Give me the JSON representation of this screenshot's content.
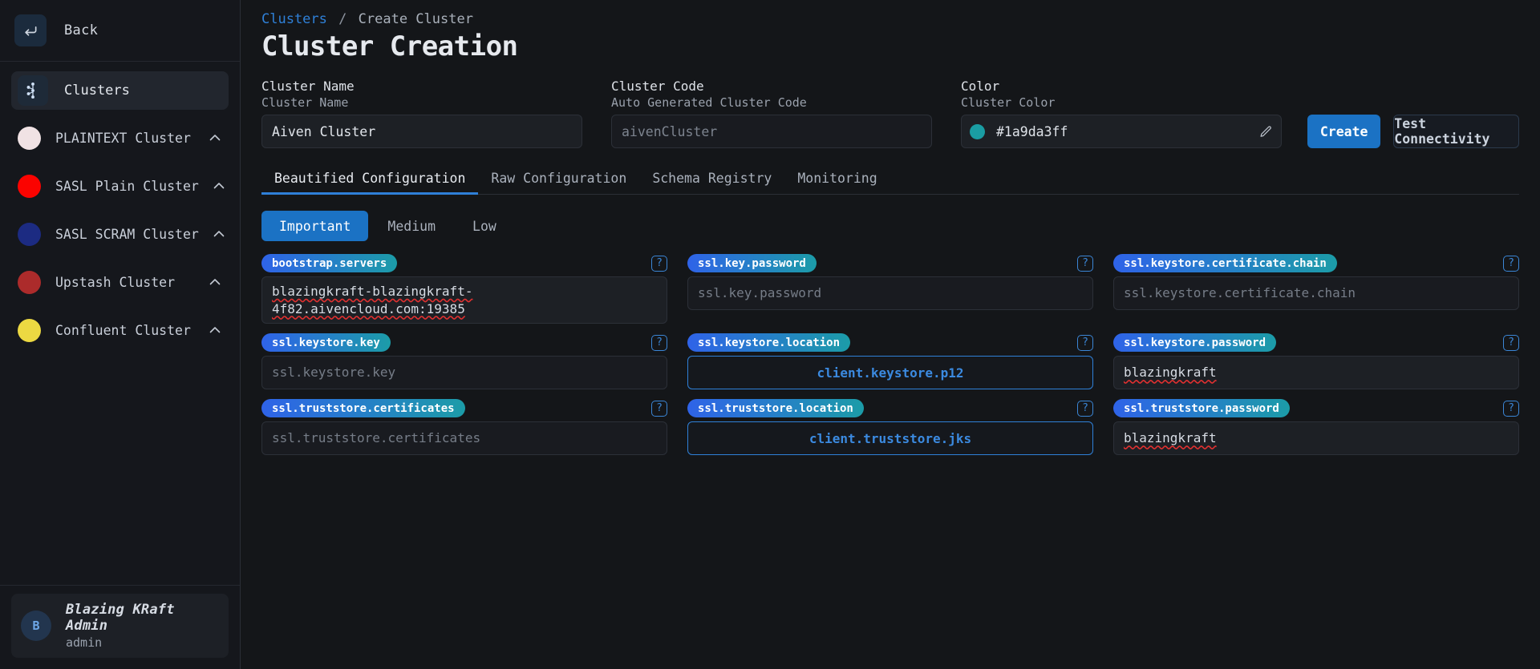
{
  "sidebar": {
    "back_label": "Back",
    "back_icon": "arrow-left-icon",
    "nav_active": {
      "label": "Clusters",
      "icon": "kafka-cluster-icon"
    },
    "clusters": [
      {
        "label": "PLAINTEXT Cluster",
        "color": "#f0e2e4",
        "chevron": "chevron-up-icon"
      },
      {
        "label": "SASL Plain Cluster",
        "color": "#fb0300",
        "chevron": "chevron-up-icon"
      },
      {
        "label": "SASL SCRAM Cluster",
        "color": "#1c2b82",
        "chevron": "chevron-up-icon"
      },
      {
        "label": "Upstash Cluster",
        "color": "#ac2b2b",
        "chevron": "chevron-up-icon"
      },
      {
        "label": "Confluent Cluster",
        "color": "#ecd942",
        "chevron": "chevron-up-icon"
      }
    ],
    "user": {
      "initial": "B",
      "name": "Blazing KRaft Admin",
      "role": "admin"
    }
  },
  "breadcrumb": {
    "root": "Clusters",
    "separator": "/",
    "current": "Create Cluster"
  },
  "page_title": "Cluster Creation",
  "form": {
    "cluster_name": {
      "title": "Cluster Name",
      "sub": "Cluster Name",
      "value": "Aiven Cluster"
    },
    "cluster_code": {
      "title": "Cluster Code",
      "sub": "Auto Generated Cluster Code",
      "placeholder": "aivenCluster"
    },
    "color": {
      "title": "Color",
      "sub": "Cluster Color",
      "value": "#1a9da3ff",
      "swatch": "#1a9da3",
      "edit_icon": "pencil-icon"
    },
    "create_label": "Create",
    "test_label": "Test Connectivity",
    "accent": "#1b72c4"
  },
  "tabs": [
    {
      "label": "Beautified Configuration",
      "active": true
    },
    {
      "label": "Raw Configuration",
      "active": false
    },
    {
      "label": "Schema Registry",
      "active": false
    },
    {
      "label": "Monitoring",
      "active": false
    }
  ],
  "priorities": [
    {
      "label": "Important",
      "active": true
    },
    {
      "label": "Medium",
      "active": false
    },
    {
      "label": "Low",
      "active": false
    }
  ],
  "help_glyph": "?",
  "configs": [
    {
      "key": "bootstrap.servers",
      "value": "blazingkraft-blazingkraft-4f82.aivencloud.com:19385",
      "kind": "value-multiline-spell"
    },
    {
      "key": "ssl.key.password",
      "value": "ssl.key.password",
      "kind": "placeholder"
    },
    {
      "key": "ssl.keystore.certificate.chain",
      "value": "ssl.keystore.certificate.chain",
      "kind": "placeholder"
    },
    {
      "key": "ssl.keystore.key",
      "value": "ssl.keystore.key",
      "kind": "placeholder"
    },
    {
      "key": "ssl.keystore.location",
      "value": "client.keystore.p12",
      "kind": "file"
    },
    {
      "key": "ssl.keystore.password",
      "value": "blazingkraft",
      "kind": "value-spell"
    },
    {
      "key": "ssl.truststore.certificates",
      "value": "ssl.truststore.certificates",
      "kind": "placeholder"
    },
    {
      "key": "ssl.truststore.location",
      "value": "client.truststore.jks",
      "kind": "file"
    },
    {
      "key": "ssl.truststore.password",
      "value": "blazingkraft",
      "kind": "value-spell"
    }
  ]
}
